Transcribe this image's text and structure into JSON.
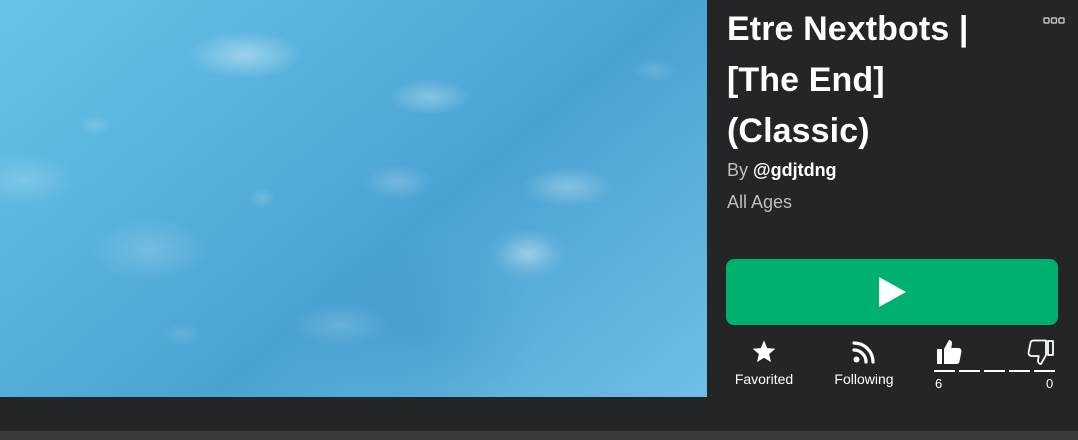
{
  "game": {
    "title": "Etre Nextbots | [The End] (Classic)",
    "creator_prefix": "By",
    "creator_handle": "@gdjtdng",
    "age_rating": "All Ages"
  },
  "actions": {
    "favorite_label": "Favorited",
    "follow_label": "Following"
  },
  "votes": {
    "up_count": "6",
    "down_count": "0",
    "up_fraction": 1.0
  },
  "icons": {
    "more": "more-icon",
    "play": "play-icon",
    "favorite": "star-icon",
    "follow": "rss-icon",
    "like": "thumbs-up-icon",
    "dislike": "thumbs-down-icon"
  },
  "colors": {
    "background": "#232527",
    "play_button": "#00b06f",
    "secondary_text": "#bdbebe"
  }
}
